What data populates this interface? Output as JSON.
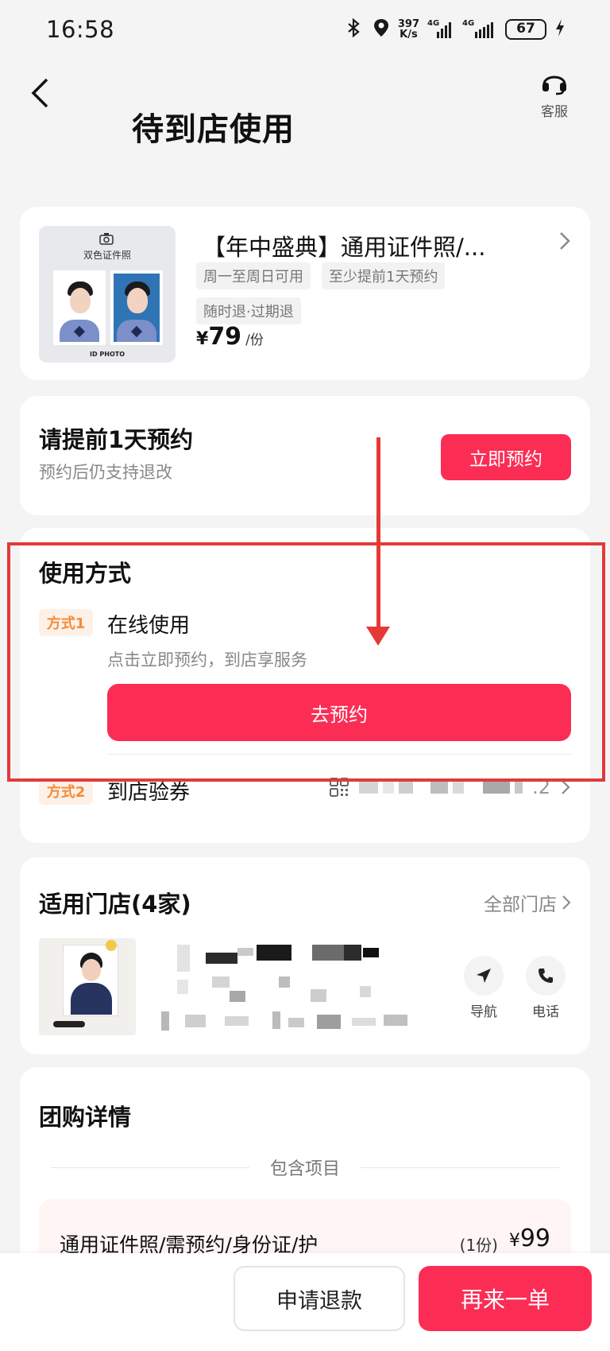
{
  "status": {
    "time": "16:58",
    "net_speed_value": "397",
    "net_speed_unit": "K/s",
    "sim1": "4G",
    "sim2": "4G",
    "battery": "67"
  },
  "header": {
    "title": "待到店使用",
    "service_label": "客服"
  },
  "product": {
    "title": "【年中盛典】通用证件照/...",
    "thumb_caption": "双色证件照",
    "thumb_brand": "ID PHOTO",
    "tags": [
      "周一至周日可用",
      "至少提前1天预约",
      "随时退·过期退"
    ],
    "price_currency": "¥",
    "price": "79",
    "price_unit": "/份"
  },
  "reserve": {
    "title": "请提前1天预约",
    "subtitle": "预约后仍支持退改",
    "button": "立即预约"
  },
  "usage": {
    "title": "使用方式",
    "mode1": {
      "badge": "方式1",
      "name": "在线使用",
      "desc": "点击立即预约，到店享服务",
      "button": "去预约"
    },
    "mode2": {
      "badge": "方式2",
      "name": "到店验券",
      "code_tail": ".2"
    }
  },
  "stores": {
    "title": "适用门店(4家)",
    "all_label": "全部门店",
    "nav_label": "导航",
    "phone_label": "电话"
  },
  "group": {
    "title": "团购详情",
    "section_label": "包含项目",
    "item": {
      "name": "通用证件照/需预约/身份证/护",
      "qty": "(1份)",
      "currency": "¥",
      "price": "99"
    }
  },
  "bottom": {
    "refund": "申请退款",
    "again": "再来一单"
  },
  "colors": {
    "primary_red": "#fb2d55",
    "annotation_red": "#e53935",
    "badge_orange": "#f28c3b"
  }
}
